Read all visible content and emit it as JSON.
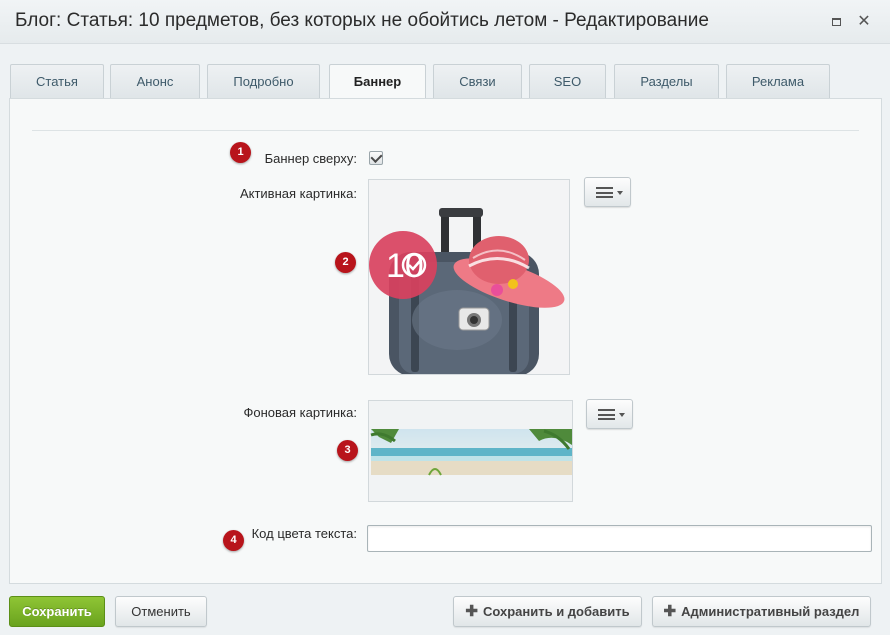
{
  "window": {
    "title": "Блог: Статья: 10 предметов, без которых не обойтись летом - Редактирование",
    "maximize_icon": "maximize-icon",
    "close_icon": "close-icon",
    "close_glyph": "✕"
  },
  "tabs": [
    {
      "label": "Статья",
      "active": false
    },
    {
      "label": "Анонс",
      "active": false
    },
    {
      "label": "Подробно",
      "active": false
    },
    {
      "label": "Баннер",
      "active": true
    },
    {
      "label": "Связи",
      "active": false
    },
    {
      "label": "SEO",
      "active": false
    },
    {
      "label": "Разделы",
      "active": false
    },
    {
      "label": "Реклама",
      "active": false
    }
  ],
  "form": {
    "banner_top": {
      "badge": "1",
      "label": "Баннер сверху:",
      "checked": true
    },
    "active_image": {
      "badge": "2",
      "label": "Активная картинка:",
      "logo_text": "10"
    },
    "background_image": {
      "badge": "3",
      "label": "Фоновая картинка:"
    },
    "text_color": {
      "badge": "4",
      "label": "Код цвета текста:",
      "value": "",
      "placeholder": ""
    }
  },
  "footer": {
    "save": "Сохранить",
    "cancel": "Отменить",
    "save_and_add": "Сохранить и добавить",
    "admin_section": "Административный раздел"
  },
  "colors": {
    "badge": "#b8141b",
    "primary_button": "#7bb32a",
    "tab_text": "#3e5a6a"
  }
}
